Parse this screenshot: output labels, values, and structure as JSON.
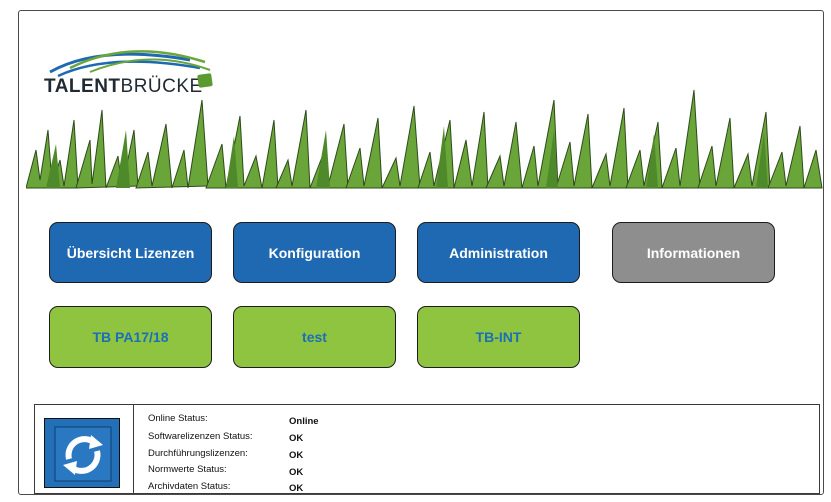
{
  "logo": {
    "text_bold": "TALENT",
    "text_regular": "BRÜCKE"
  },
  "buttons_row1": [
    {
      "label": "Übersicht Lizenzen",
      "color": "#1f69b3"
    },
    {
      "label": "Konfiguration",
      "color": "#1f69b3"
    },
    {
      "label": "Administration",
      "color": "#1f69b3"
    },
    {
      "label": "Informationen",
      "color": "#8e8e8e"
    }
  ],
  "buttons_row2": [
    {
      "label": "TB PA17/18",
      "color": "#8fc441"
    },
    {
      "label": "test",
      "color": "#8fc441"
    },
    {
      "label": "TB-INT",
      "color": "#8fc441"
    }
  ],
  "status": [
    {
      "label": "Online Status:",
      "value": "Online"
    },
    {
      "label": "Softwarelizenzen Status:",
      "value": "OK"
    },
    {
      "label": "Durchführungslizenzen:",
      "value": "OK"
    },
    {
      "label": "Normwerte Status:",
      "value": "OK"
    },
    {
      "label": "Archivdaten Status:",
      "value": "OK"
    }
  ],
  "icons": {
    "refresh": "refresh-icon",
    "logo": "talentbruecke-logo"
  }
}
